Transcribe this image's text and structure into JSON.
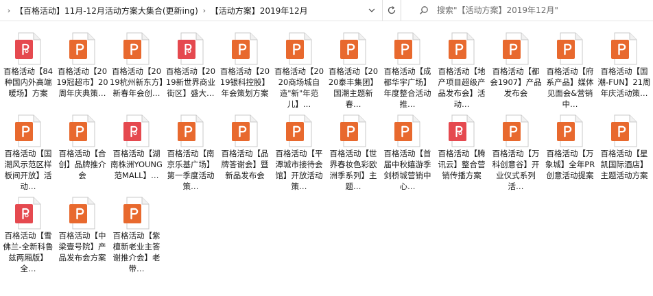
{
  "address_bar": {
    "breadcrumbs": [
      "【百格活动】11月-12月活动方案大集合(更新ing)",
      "【活动方案】2019年12月"
    ]
  },
  "search": {
    "placeholder": "搜索\"【活动方案】2019年12月\""
  },
  "colors": {
    "ppt_orange": "#e8692e",
    "pdf_red": "#e5494f"
  },
  "files": [
    {
      "label": "百格活动【84种国内外高端暖场】方案",
      "type": "pdf"
    },
    {
      "label": "百格活动【2019冠超市】20周年庆典策…",
      "type": "ppt"
    },
    {
      "label": "百格活动【2019杭州新东方】新春年会创…",
      "type": "ppt"
    },
    {
      "label": "百格活动【2019新世界商业街区】盛大…",
      "type": "pdf"
    },
    {
      "label": "百格活动【2019银科控股】年会策划方案",
      "type": "ppt"
    },
    {
      "label": "百格活动【2020商场城自造\"新\"年范儿】…",
      "type": "ppt"
    },
    {
      "label": "百格活动【2020泰丰集团】国潮主题新春…",
      "type": "ppt"
    },
    {
      "label": "百格活动【成都华宇广场】年度整合活动推…",
      "type": "ppt"
    },
    {
      "label": "百格活动【地产项目超级产品发布会】活动…",
      "type": "ppt"
    },
    {
      "label": "百格活动【都会1907】产品发布会",
      "type": "ppt"
    },
    {
      "label": "百格活动【府系产品】媒体见面会&营销中…",
      "type": "ppt"
    },
    {
      "label": "百格活动【国潮-FUN】21周年庆活动策…",
      "type": "ppt"
    },
    {
      "label": "百格活动【国潮风示范区样板间开放】活动…",
      "type": "ppt"
    },
    {
      "label": "百格活动【合创】品牌推介会",
      "type": "ppt"
    },
    {
      "label": "百格活动【湖南株洲YOUNG范MALL】…",
      "type": "pdf"
    },
    {
      "label": "百格活动【南京乐基广场】第一季度活动策…",
      "type": "ppt"
    },
    {
      "label": "百格活动【品牌答谢会】暨新品发布会",
      "type": "ppt"
    },
    {
      "label": "百格活动【平潭城市接待会馆】开放活动策…",
      "type": "ppt"
    },
    {
      "label": "百格活动【世界春妆色彩欧洲季系列】主题…",
      "type": "ppt"
    },
    {
      "label": "百格活动【首届中秋嬉游季剑桥城营销中心…",
      "type": "ppt"
    },
    {
      "label": "百格活动【腾讯云】整合营销传播方案",
      "type": "pdf"
    },
    {
      "label": "百格活动【万科创意谷】开业仪式系列活…",
      "type": "ppt"
    },
    {
      "label": "百格活动【万象城】全年PR创意活动提案",
      "type": "ppt"
    },
    {
      "label": "百格活动【星凯国际酒店】主题活动方案",
      "type": "ppt"
    },
    {
      "label": "百格活动【雪佛兰-全新科鲁兹两厢版】全…",
      "type": "pdf"
    },
    {
      "label": "百格活动【中梁壹号院】产品发布会方案",
      "type": "ppt"
    },
    {
      "label": "百格活动【紫檀新老业主答谢推介会】老带…",
      "type": "ppt"
    }
  ]
}
